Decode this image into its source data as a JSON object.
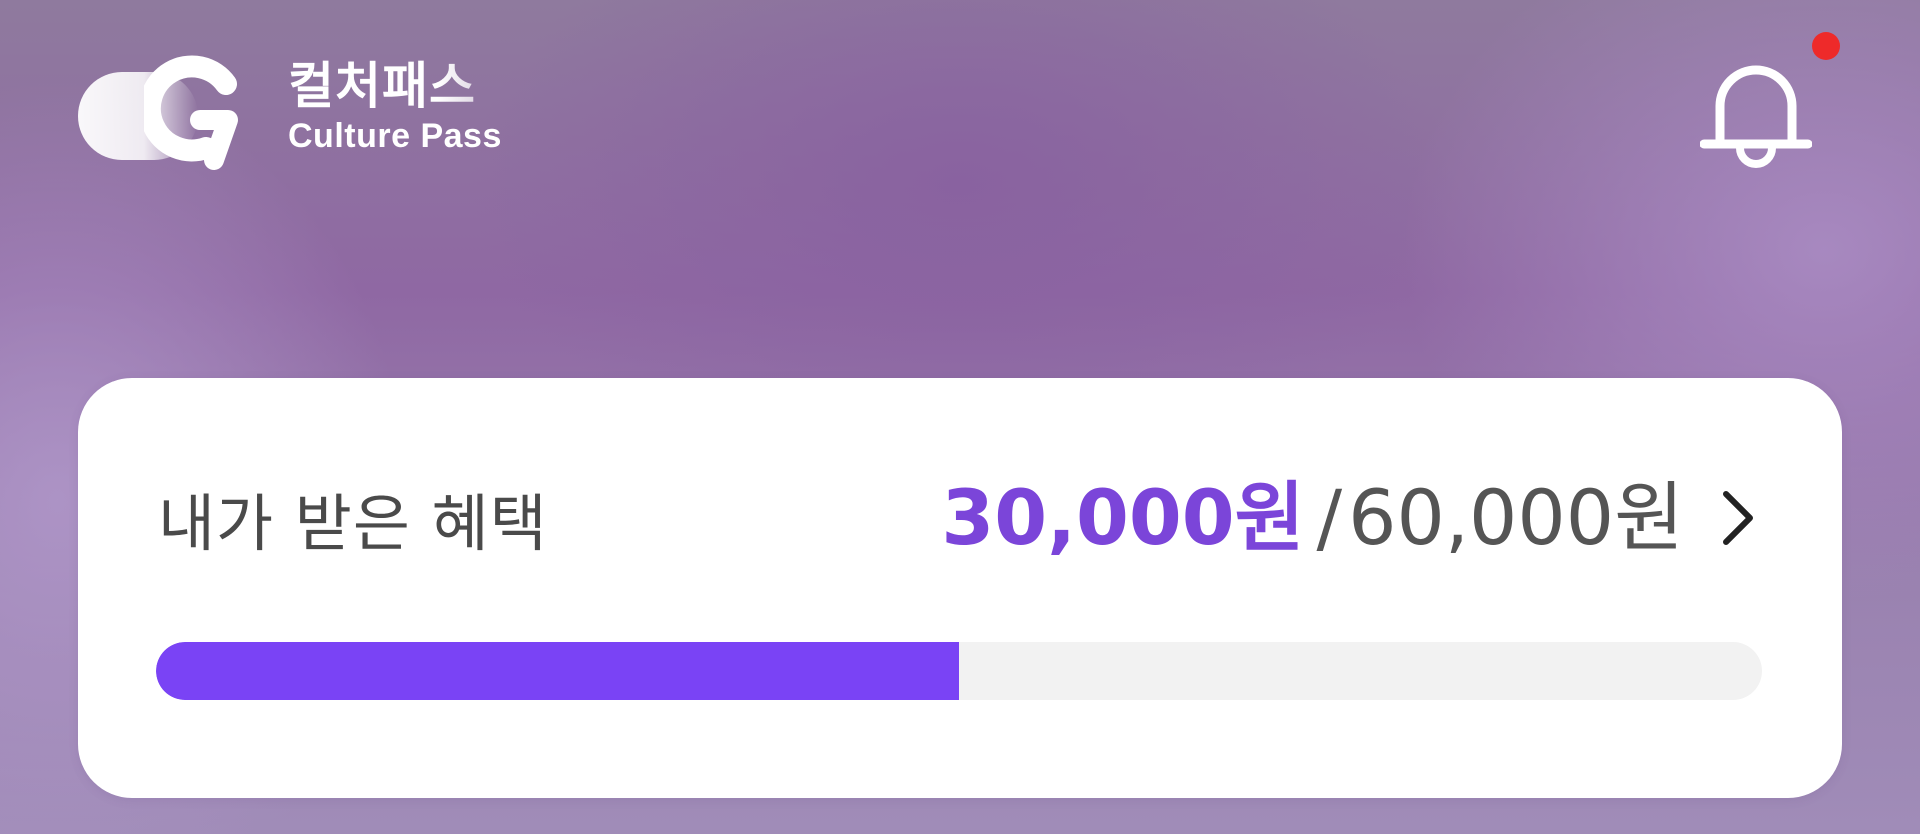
{
  "header": {
    "logo": {
      "name_kr": "컬처패스",
      "name_en": "Culture Pass"
    },
    "notification": {
      "icon": "bell-icon",
      "has_unread": true,
      "dot_color": "#ee2a2a"
    }
  },
  "benefit_card": {
    "title": "내가 받은 혜택",
    "received_amount": "30,000원",
    "separator": "/",
    "total_amount": "60,000원",
    "chevron_icon": "chevron-right-icon",
    "progress": {
      "fraction": 0.5,
      "fill_color": "#7a43f5",
      "track_color": "#f2f2f2"
    }
  },
  "colors": {
    "accent": "#7b45d9",
    "background": "#8f68a3"
  }
}
